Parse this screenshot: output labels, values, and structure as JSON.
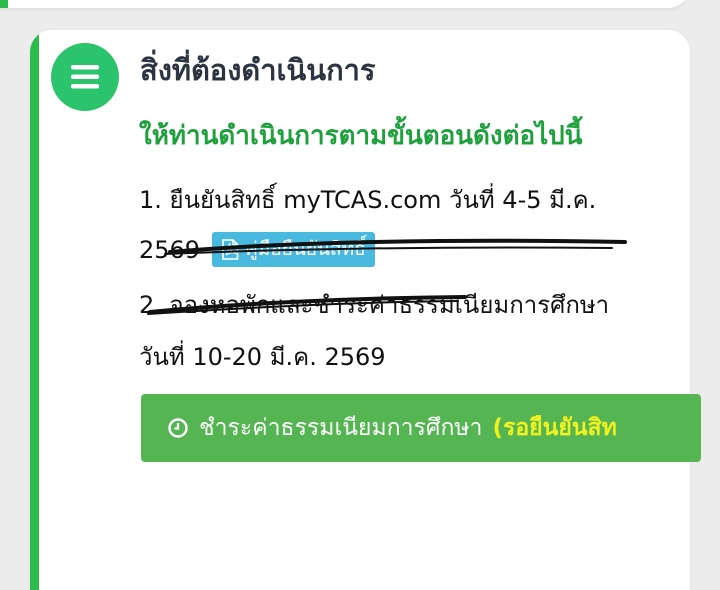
{
  "section": {
    "title": "สิ่งที่ต้องดำเนินการ",
    "subtitle": "ให้ท่านดำเนินการตามขั้นตอนดังต่อไปนี้",
    "menu_icon": "hamburger-menu-icon"
  },
  "steps": {
    "step1_line1": "1. ยืนยันสิทธิ์ myTCAS.com วันที่ 4-5 มี.ค.",
    "step1_line2": "2569",
    "manual_button": {
      "label": "คู่มือยืนยันสิทธิ์",
      "icon": "pdf-icon"
    },
    "step2_line1": "2. จองหอพักและชำระค่าธรรมเนียมการศึกษา",
    "step2_line2": "วันที่ 10-20 มี.ค. 2569"
  },
  "pay_button": {
    "label": "ชำระค่าธรรมเนียมการศึกษา",
    "status": "(รอยืนยันสิท",
    "icon": "clock-icon"
  },
  "colors": {
    "accent_green": "#2dbb4e",
    "subtitle_green": "#1ea13d",
    "icon_circle": "#2bc36b",
    "manual_button_bg": "#4ab9df",
    "pay_button_bg": "#55b552",
    "pay_status_yellow": "#f1f21f"
  }
}
